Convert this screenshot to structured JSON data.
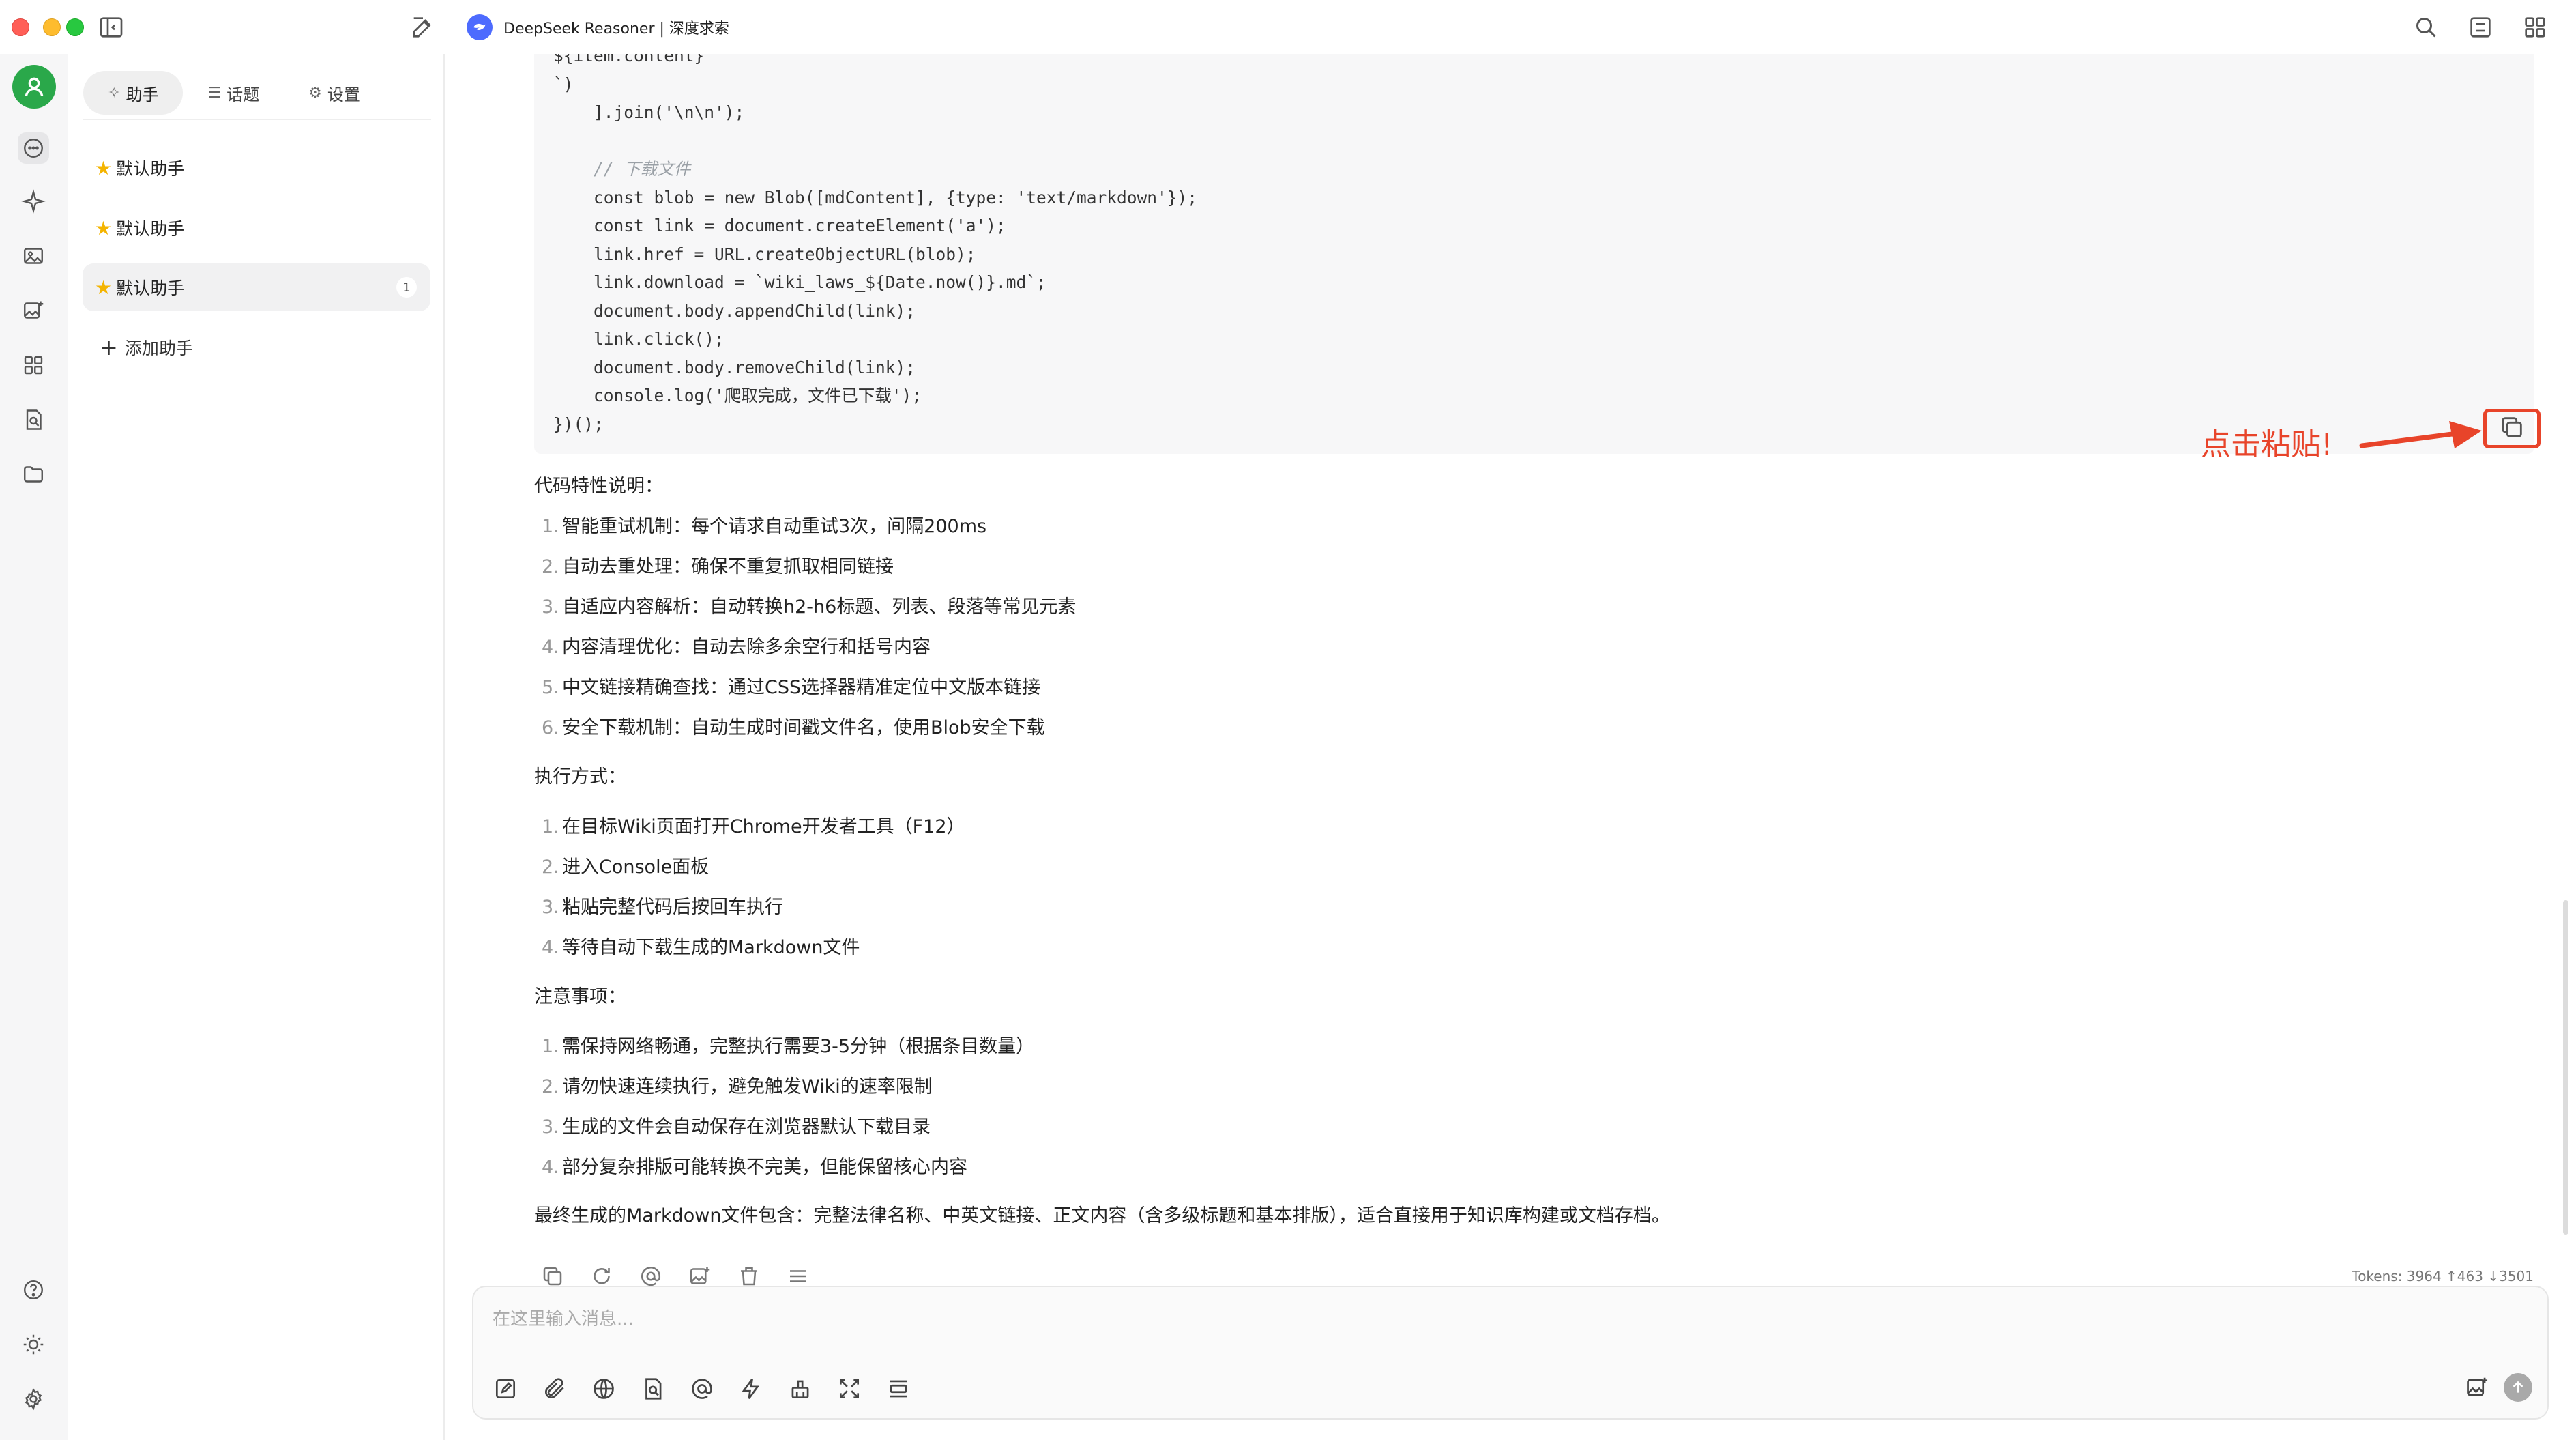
{
  "window": {
    "model_title": "DeepSeek Reasoner | 深度求索"
  },
  "panel": {
    "tabs": [
      {
        "label": "助手",
        "icon": "sparkle-icon",
        "active": true
      },
      {
        "label": "话题",
        "icon": "list-icon",
        "active": false
      },
      {
        "label": "设置",
        "icon": "gear-icon",
        "active": false
      }
    ],
    "assistants": [
      {
        "label": "默认助手",
        "icon": "star-icon"
      },
      {
        "label": "默认助手",
        "icon": "star-icon"
      },
      {
        "label": "默认助手",
        "icon": "star-icon",
        "count": "1",
        "active": true
      }
    ],
    "add_label": "添加助手"
  },
  "code": {
    "lines": [
      "${item.content}",
      "`)",
      "    ].join('\\n\\n');",
      "",
      "    // 下载文件",
      "    const blob = new Blob([mdContent], {type: 'text/markdown'});",
      "    const link = document.createElement('a');",
      "    link.href = URL.createObjectURL(blob);",
      "    link.download = `wiki_laws_${Date.now()}.md`;",
      "    document.body.appendChild(link);",
      "    link.click();",
      "    document.body.removeChild(link);",
      "    console.log('爬取完成，文件已下载');",
      "})();"
    ]
  },
  "annotation": {
    "text": "点击粘贴!",
    "color": "#e8442a"
  },
  "message": {
    "features_title": "代码特性说明：",
    "features": [
      "智能重试机制：每个请求自动重试3次，间隔200ms",
      "自动去重处理：确保不重复抓取相同链接",
      "自适应内容解析：自动转换h2-h6标题、列表、段落等常见元素",
      "内容清理优化：自动去除多余空行和括号内容",
      "中文链接精确查找：通过CSS选择器精准定位中文版本链接",
      "安全下载机制：自动生成时间戳文件名，使用Blob安全下载"
    ],
    "exec_title": "执行方式：",
    "exec_steps": [
      "在目标Wiki页面打开Chrome开发者工具（F12）",
      "进入Console面板",
      "粘贴完整代码后按回车执行",
      "等待自动下载生成的Markdown文件"
    ],
    "notes_title": "注意事项：",
    "notes": [
      "需保持网络畅通，完整执行需要3-5分钟（根据条目数量）",
      "请勿快速连续执行，避免触发Wiki的速率限制",
      "生成的文件会自动保存在浏览器默认下载目录",
      "部分复杂排版可能转换不完美，但能保留核心内容"
    ],
    "summary": "最终生成的Markdown文件包含：完整法律名称、中英文链接、正文内容（含多级标题和基本排版），适合直接用于知识库构建或文档存档。",
    "tokens": "Tokens: 3964 ↑463 ↓3501"
  },
  "input": {
    "placeholder": "在这里输入消息..."
  },
  "colors": {
    "accent_green": "#2aa84a",
    "logo_blue": "#4d6bfe",
    "highlight_red": "#e8442a"
  }
}
